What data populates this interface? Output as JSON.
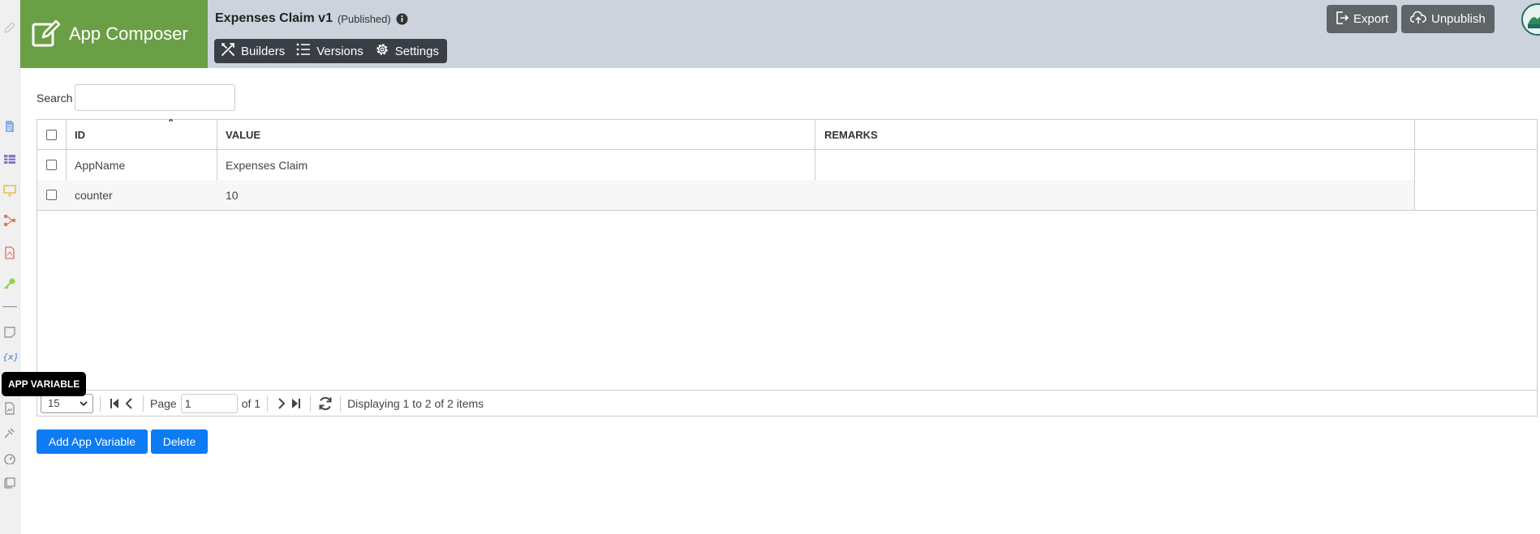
{
  "brand": {
    "title": "App Composer"
  },
  "app": {
    "name": "Expenses Claim v1",
    "status": "(Published)"
  },
  "nav": {
    "builders": "Builders",
    "versions": "Versions",
    "settings": "Settings"
  },
  "actions": {
    "export": "Export",
    "unpublish": "Unpublish"
  },
  "tooltip": "APP VARIABLE",
  "search": {
    "label": "Search",
    "value": ""
  },
  "table": {
    "headers": {
      "id": "ID",
      "value": "VALUE",
      "remarks": "REMARKS"
    },
    "rows": [
      {
        "id": "AppName",
        "value": "Expenses Claim",
        "remarks": ""
      },
      {
        "id": "counter",
        "value": "10",
        "remarks": ""
      }
    ]
  },
  "pager": {
    "page_size": "15",
    "page_label": "Page",
    "page": "1",
    "of_label": "of 1",
    "display": "Displaying 1 to 2 of 2 items"
  },
  "buttons": {
    "add": "Add App Variable",
    "delete": "Delete"
  },
  "colors": {
    "brand": "#6a9f45",
    "header": "#ccd3dc",
    "nav": "#3a3f46",
    "primary": "#0d7bf2"
  }
}
